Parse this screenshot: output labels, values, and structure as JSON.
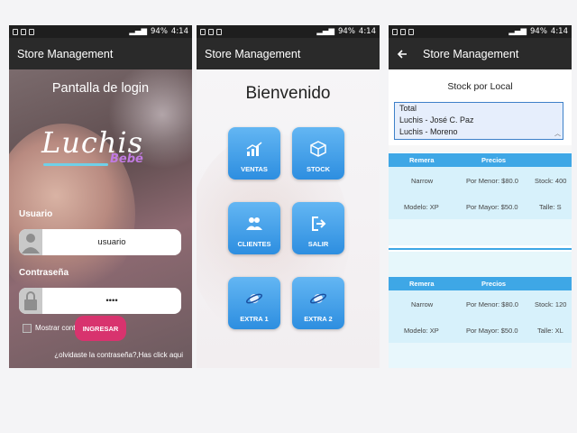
{
  "status": {
    "battery": "94%",
    "time": "4:14"
  },
  "app_title": "Store Management",
  "login": {
    "title": "Pantalla de login",
    "logo_text": "Luchis",
    "logo_sub": "Bebé",
    "user_label": "Usuario",
    "user_value": "usuario",
    "password_label": "Contraseña",
    "password_value": "••••",
    "show_password": "Mostrar contraseña",
    "submit": "INGRESAR",
    "forgot": "¿olvidaste la contraseña?,Has click aqui"
  },
  "menu": {
    "title": "Bienvenido",
    "tiles": [
      {
        "label": "VENTAS",
        "icon": "chart-icon"
      },
      {
        "label": "STOCK",
        "icon": "box-icon"
      },
      {
        "label": "CLIENTES",
        "icon": "users-icon"
      },
      {
        "label": "SALIR",
        "icon": "exit-icon"
      },
      {
        "label": "EXTRA 1",
        "icon": "planet-icon"
      },
      {
        "label": "EXTRA 2",
        "icon": "planet-icon"
      }
    ]
  },
  "stock": {
    "title": "Stock por Local",
    "locations": [
      "Total",
      "Luchis - José C. Paz",
      "Luchis - Moreno"
    ],
    "headers": [
      "Remera",
      "Precios"
    ],
    "items": [
      {
        "row1": [
          "Narrow",
          "Por Menor: $80.0",
          "Stock: 400"
        ],
        "row2": [
          "Modelo: XP",
          "Por Mayor: $50.0",
          "Talle: S"
        ]
      },
      {
        "row1": [
          "Narrow",
          "Por Menor: $80.0",
          "Stock: 120"
        ],
        "row2": [
          "Modelo: XP",
          "Por Mayor: $50.0",
          "Talle: XL"
        ]
      }
    ]
  },
  "colors": {
    "accent": "#3ea7e6",
    "submit": "#d8336e",
    "appbar": "#2a2a2a"
  }
}
